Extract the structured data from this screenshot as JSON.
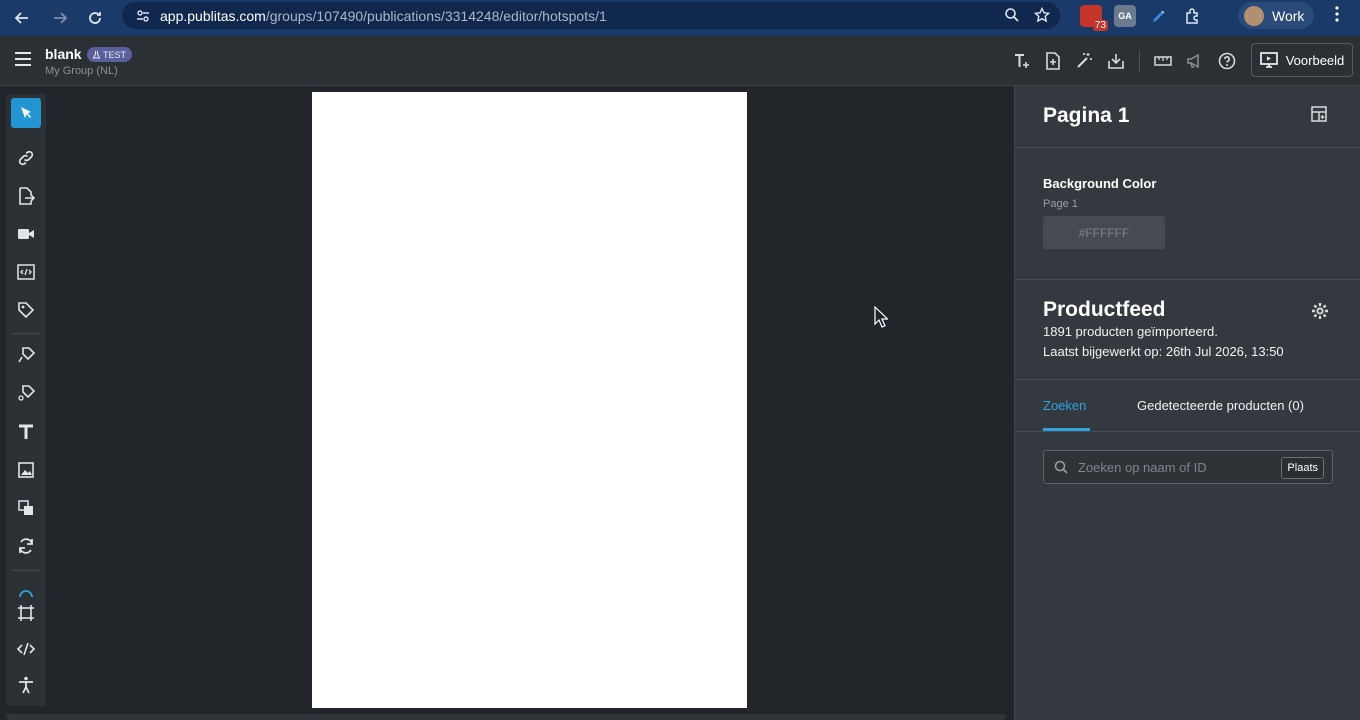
{
  "browser": {
    "url_host": "app.publitas.com",
    "url_path": "/groups/107490/publications/3314248/editor/hotspots/1",
    "ext_badge": "73",
    "ext_ga_label": "GA",
    "profile_name": "Work"
  },
  "header": {
    "doc_title": "blank",
    "badge": "TEST",
    "group": "My Group (NL)",
    "preview_label": "Voorbeeld"
  },
  "panel": {
    "page_title": "Pagina 1",
    "background": {
      "label": "Background Color",
      "page_label": "Page 1",
      "value": "#FFFFFF"
    },
    "feed": {
      "title": "Productfeed",
      "imported": "1891 producten geïmporteerd.",
      "updated": "Laatst bijgewerkt op: 26th Jul 2026, 13:50"
    },
    "tabs": [
      {
        "label": "Zoeken"
      },
      {
        "label": "Gedetecteerde producten (0)"
      }
    ],
    "search": {
      "placeholder": "Zoeken op naam of ID",
      "button": "Plaats"
    }
  },
  "colors": {
    "accent": "#2196d3",
    "tab_active": "#2fa3df",
    "panel_bg": "#34393f",
    "canvas_bg": "#22262b",
    "browser_bar": "#1a3a6a"
  }
}
